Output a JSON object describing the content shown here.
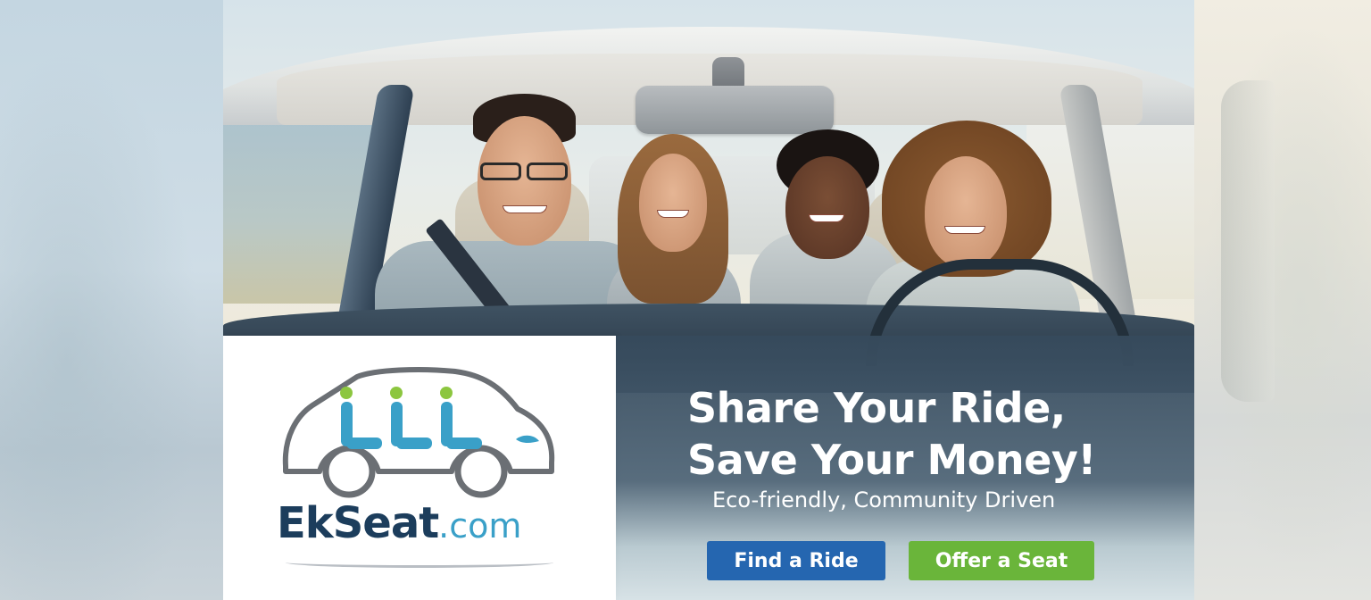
{
  "brand": {
    "name": "EkSeat",
    "domain": ".com",
    "colors": {
      "navy": "#1c3d5c",
      "sky": "#3aa0c8",
      "lime": "#8cc63f"
    }
  },
  "hero": {
    "headline_line1": "Share Your Ride,",
    "headline_line2": "Save Your Money!",
    "tagline": "Eco-friendly, Community Driven"
  },
  "actions": {
    "find_ride": {
      "label": "Find a Ride",
      "color": "#2566b0"
    },
    "offer_seat": {
      "label": "Offer a Seat",
      "color": "#6ab53a"
    }
  }
}
